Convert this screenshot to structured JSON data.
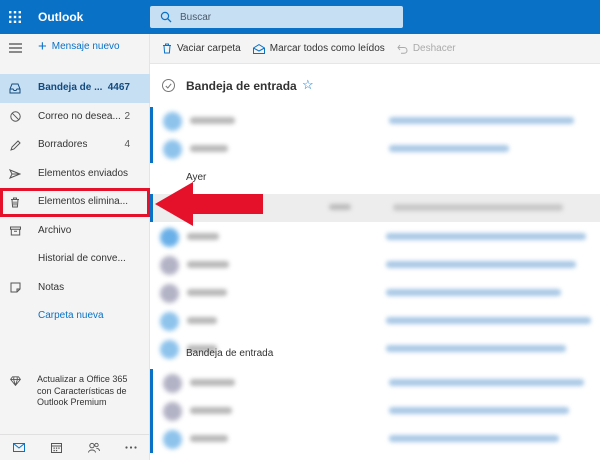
{
  "app": {
    "brand": "Outlook",
    "accent_color": "#0a72c6",
    "highlight_color": "#e5112b"
  },
  "search": {
    "placeholder": "Buscar",
    "icon": "search-icon"
  },
  "sidebar": {
    "new_message_label": "Mensaje nuevo",
    "folders": [
      {
        "label": "Bandeja de ...",
        "count": "4467",
        "icon": "inbox-icon"
      },
      {
        "label": "Correo no desea...",
        "count": "2",
        "icon": "junk-icon"
      },
      {
        "label": "Borradores",
        "count": "4",
        "icon": "pencil-icon"
      },
      {
        "label": "Elementos enviados",
        "count": "",
        "icon": "send-icon"
      },
      {
        "label": "Elementos elimina...",
        "count": "",
        "icon": "trash-icon"
      },
      {
        "label": "Archivo",
        "count": "",
        "icon": "archive-icon"
      },
      {
        "label": "Historial de conve...",
        "count": "",
        "icon": ""
      },
      {
        "label": "Notas",
        "count": "",
        "icon": "note-icon"
      },
      {
        "label": "Carpeta nueva",
        "count": "",
        "icon": ""
      }
    ],
    "premium_text": "Actualizar a Office 365 con Características de Outlook Premium",
    "bottom_nav": [
      "mail-icon",
      "calendar-icon",
      "people-icon",
      "more-icon"
    ]
  },
  "toolbar": {
    "empty_folder_label": "Vaciar carpeta",
    "mark_all_read_label": "Marcar todos como leídos",
    "undo_label": "Deshacer"
  },
  "message_list": {
    "title": "Bandeja de entrada",
    "groups": [
      {
        "label": "Ayer"
      },
      {
        "label": "Bandeja de entrada"
      }
    ]
  }
}
